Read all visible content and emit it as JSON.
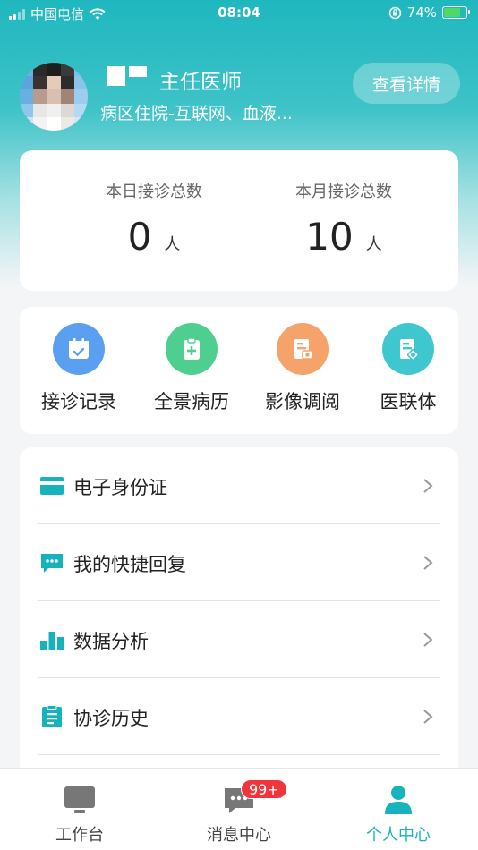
{
  "status_bar": {
    "carrier": "中国电信",
    "time": "08:04",
    "battery": "74%",
    "battery_level": 0.74
  },
  "profile": {
    "title": "主任医师",
    "department": "病区住院-互联网、血液...",
    "detail_button": "查看详情"
  },
  "stats": {
    "today": {
      "label": "本日接诊总数",
      "value": "0",
      "unit": "人"
    },
    "month": {
      "label": "本月接诊总数",
      "value": "10",
      "unit": "人"
    }
  },
  "quick_actions": [
    {
      "label": "接诊记录",
      "icon": "calendar-check-icon",
      "color": "#5b9ff0"
    },
    {
      "label": "全景病历",
      "icon": "clipboard-plus-icon",
      "color": "#4fcf8f"
    },
    {
      "label": "影像调阅",
      "icon": "image-doc-icon",
      "color": "#f5a36a"
    },
    {
      "label": "医联体",
      "icon": "doc-link-icon",
      "color": "#3ec7cf"
    }
  ],
  "menu": [
    {
      "label": "电子身份证",
      "icon": "id-card-icon"
    },
    {
      "label": "我的快捷回复",
      "icon": "chat-bubble-icon"
    },
    {
      "label": "数据分析",
      "icon": "bar-chart-icon"
    },
    {
      "label": "协诊历史",
      "icon": "clipboard-list-icon"
    }
  ],
  "tab_bar": {
    "tabs": [
      {
        "label": "工作台",
        "icon": "monitor-icon"
      },
      {
        "label": "消息中心",
        "icon": "message-icon",
        "badge": "99+"
      },
      {
        "label": "个人中心",
        "icon": "person-icon",
        "active": true
      }
    ]
  },
  "colors": {
    "accent": "#17b3bd",
    "badge": "#f0363c"
  }
}
